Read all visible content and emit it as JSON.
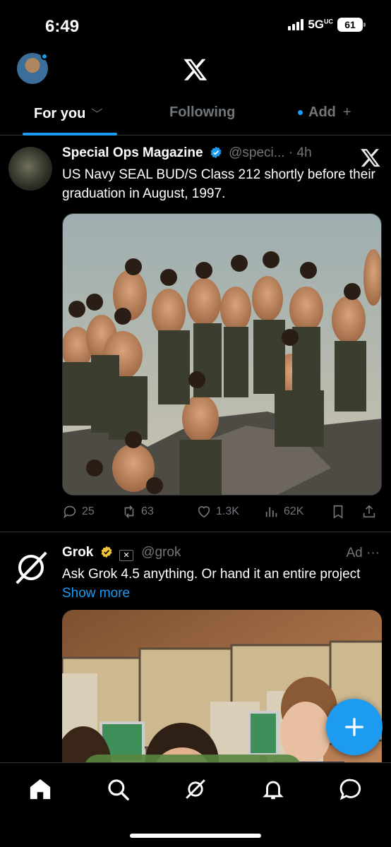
{
  "status": {
    "time": "6:49",
    "network": "5G",
    "network_sup": "UC",
    "battery": "61"
  },
  "header": {
    "logo": "x-logo"
  },
  "tabs": [
    {
      "label": "For you",
      "active": true
    },
    {
      "label": "Following",
      "active": false
    },
    {
      "label": "Add",
      "active": false
    }
  ],
  "posts": [
    {
      "name": "Special Ops Magazine",
      "handle": "@speci...",
      "separator": "·",
      "time": "4h",
      "text": "US Navy SEAL BUD/S Class 212 shortly before their graduation in August, 1997.",
      "stats": {
        "replies": "25",
        "reposts": "63",
        "likes": "1.3K",
        "views": "62K"
      }
    },
    {
      "name": "Grok",
      "handle": "@grok",
      "ad_label": "Ad",
      "more": "···",
      "text": "Ask Grok 4.5 anything. Or hand it an entire project",
      "show_more": "Show more"
    }
  ],
  "colors": {
    "accent": "#1d9bf0",
    "muted": "#71767b",
    "gold": "#f4c43b",
    "background": "#000000"
  },
  "icons": [
    "home-icon",
    "search-icon",
    "grok-icon",
    "notifications-icon",
    "messages-icon",
    "compose-icon"
  ]
}
